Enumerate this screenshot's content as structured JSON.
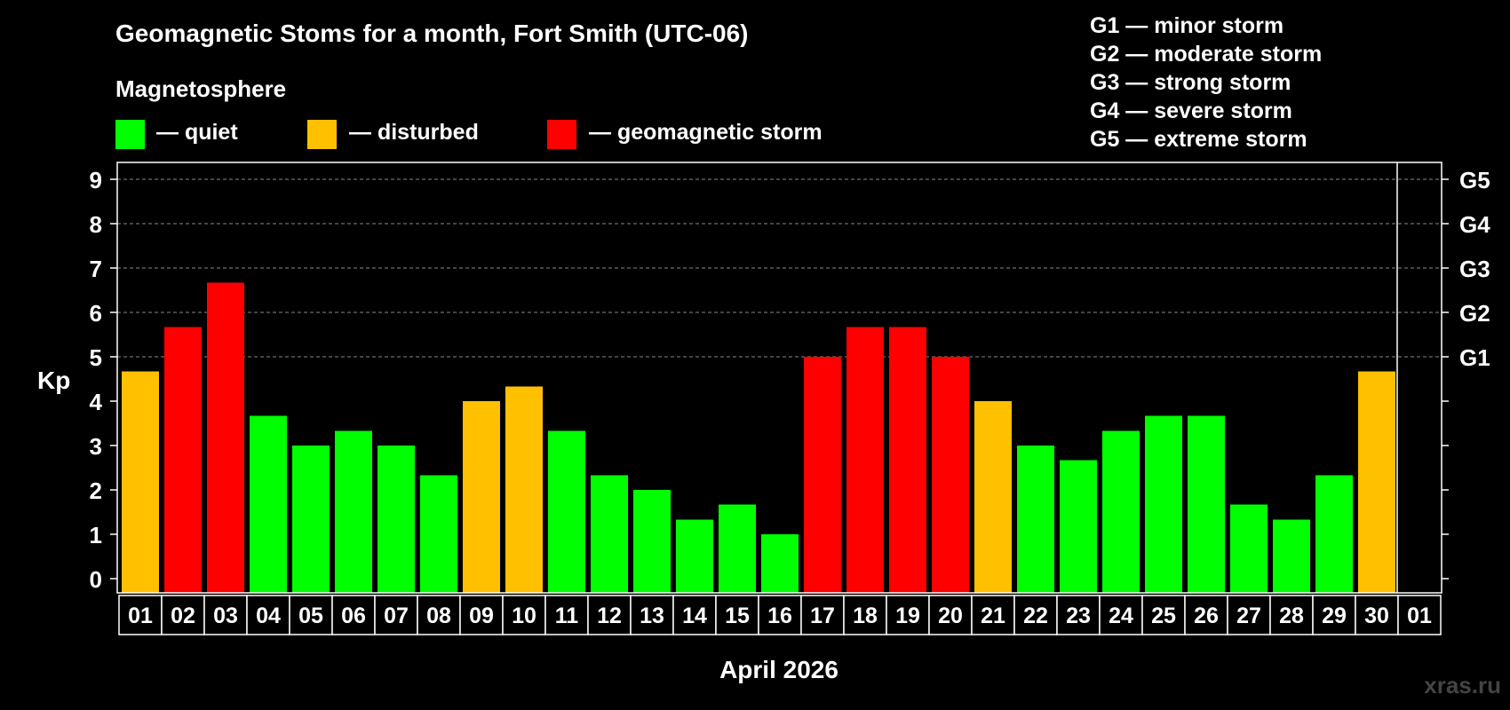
{
  "title": "Geomagnetic Stoms for a month, Fort Smith (UTC-06)",
  "legend": {
    "heading": "Magnetosphere",
    "items": [
      {
        "label": "— quiet",
        "color": "#00ff00"
      },
      {
        "label": "— disturbed",
        "color": "#ffc000"
      },
      {
        "label": "— geomagnetic storm",
        "color": "#ff0000"
      }
    ]
  },
  "g_scale": [
    "G1 — minor storm",
    "G2 — moderate storm",
    "G3 — strong storm",
    "G4 — severe storm",
    "G5 — extreme storm"
  ],
  "watermark": "xras.ru",
  "colors": {
    "quiet": "#00ff00",
    "disturbed": "#ffc000",
    "storm": "#ff0000",
    "background": "#000000",
    "axis": "#ffffff",
    "grid": "#888888"
  },
  "chart_data": {
    "type": "bar",
    "xlabel": "April 2026",
    "ylabel": "Kp",
    "ylim": [
      0,
      9
    ],
    "y_ticks": [
      "0",
      "1",
      "2",
      "3",
      "4",
      "5",
      "6",
      "7",
      "8",
      "9"
    ],
    "right_ticks": [
      {
        "value": 5,
        "label": "G1"
      },
      {
        "value": 6,
        "label": "G2"
      },
      {
        "value": 7,
        "label": "G3"
      },
      {
        "value": 8,
        "label": "G4"
      },
      {
        "value": 9,
        "label": "G5"
      }
    ],
    "grid": "dashed horizontal at 5-9",
    "categories": [
      "01",
      "02",
      "03",
      "04",
      "05",
      "06",
      "07",
      "08",
      "09",
      "10",
      "11",
      "12",
      "13",
      "14",
      "15",
      "16",
      "17",
      "18",
      "19",
      "20",
      "21",
      "22",
      "23",
      "24",
      "25",
      "26",
      "27",
      "28",
      "29",
      "30",
      "01"
    ],
    "values": [
      4.67,
      5.67,
      6.67,
      3.67,
      3.0,
      3.33,
      3.0,
      2.33,
      4.0,
      4.33,
      3.33,
      2.33,
      2.0,
      1.33,
      1.67,
      1.0,
      5.0,
      5.67,
      5.67,
      5.0,
      4.0,
      3.0,
      2.67,
      3.33,
      3.67,
      3.67,
      1.67,
      1.33,
      2.33,
      4.67,
      null
    ],
    "levels": [
      "disturbed",
      "storm",
      "storm",
      "quiet",
      "quiet",
      "quiet",
      "quiet",
      "quiet",
      "disturbed",
      "disturbed",
      "quiet",
      "quiet",
      "quiet",
      "quiet",
      "quiet",
      "quiet",
      "storm",
      "storm",
      "storm",
      "storm",
      "disturbed",
      "quiet",
      "quiet",
      "quiet",
      "quiet",
      "quiet",
      "quiet",
      "quiet",
      "quiet",
      "disturbed",
      null
    ]
  }
}
